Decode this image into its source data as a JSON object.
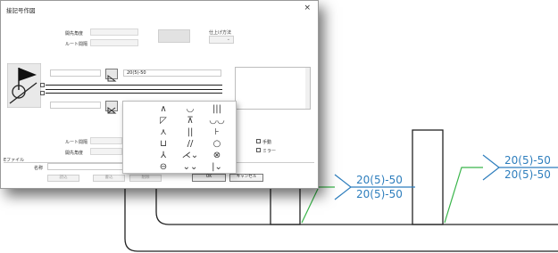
{
  "dialog": {
    "title": "接記号作図",
    "close_glyph": "×",
    "groove_angle_label": "開先角度",
    "root_gap_label": "ルート間隔",
    "finish_method_label": "仕上げ方法",
    "finish_method_value": "⌄",
    "weld_text": "20(5)-50",
    "palette_symbols": [
      "∧",
      "◡",
      "|||",
      "◸",
      "⊼",
      "◡◡",
      "⋏",
      "||",
      "⊦",
      "⊔",
      "//",
      "○",
      "⅄",
      "⋌⌄",
      "⊗",
      "⊖",
      "⌄⌄",
      "|⌄"
    ],
    "lower_root_gap_label": "ルート間隔",
    "lower_groove_angle_label": "開先角度",
    "manual_label": "手動",
    "mirror_label": "ミラー",
    "file_label": "Eファイル",
    "name_label": "名称",
    "buttons": {
      "read": "読込",
      "write": "書込",
      "delete": "削除",
      "ok": "OK",
      "cancel": "キャンセル"
    }
  },
  "canvas": {
    "label1_top": "20(5)-50",
    "label1_bottom": "20(5)-50",
    "label2_top": "20(5)-50",
    "label2_bottom": "20(5)-50"
  },
  "colors": {
    "accent": "#2e7ebd",
    "leader": "#39b54a",
    "outline": "#222222"
  }
}
